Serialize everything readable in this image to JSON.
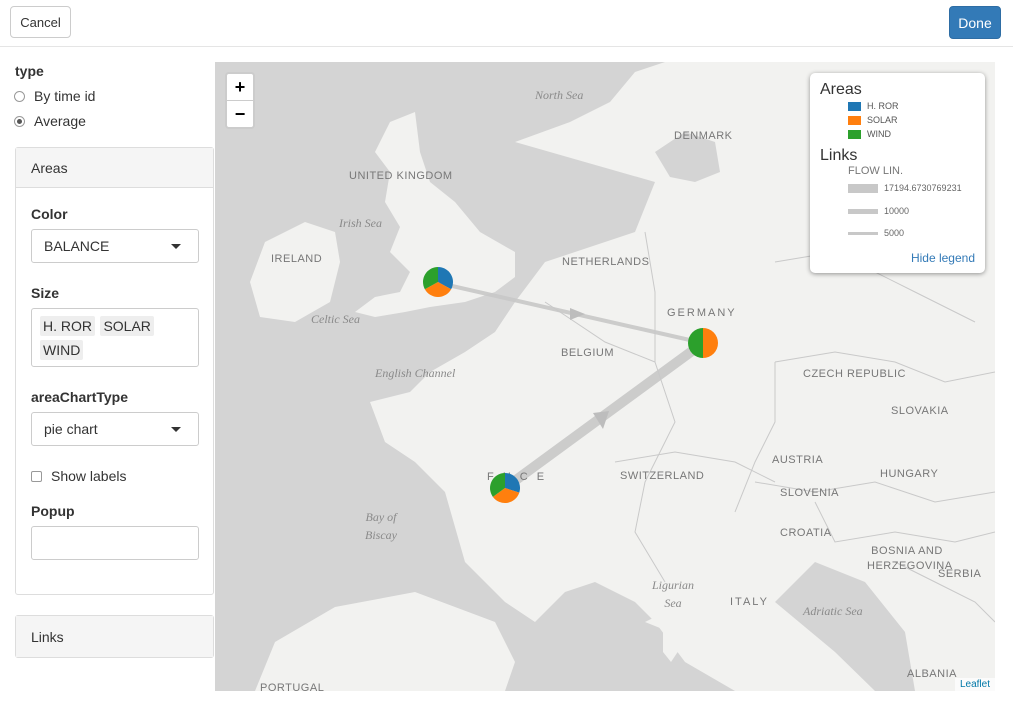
{
  "header": {
    "cancel_label": "Cancel",
    "done_label": "Done"
  },
  "sidebar": {
    "type_label": "type",
    "type_options": [
      "By time id",
      "Average"
    ],
    "type_selected": "Average",
    "areas_panel": {
      "title": "Areas",
      "color_label": "Color",
      "color_value": "BALANCE",
      "size_label": "Size",
      "size_tags": [
        "H. ROR",
        "SOLAR",
        "WIND"
      ],
      "chart_type_label": "areaChartType",
      "chart_type_value": "pie chart",
      "show_labels": "Show labels",
      "popup_label": "Popup",
      "popup_value": ""
    },
    "links_panel": {
      "title": "Links"
    }
  },
  "map": {
    "zoom_in": "+",
    "zoom_out": "−",
    "attribution": "Leaflet",
    "labels": {
      "north_sea": "North Sea",
      "denmark": "DENMARK",
      "uk": "UNITED KINGDOM",
      "irish_sea": "Irish Sea",
      "ireland": "IRELAND",
      "netherlands": "NETHERLANDS",
      "germany": "GERMANY",
      "celtic_sea": "Celtic Sea",
      "belgium": "BELGIUM",
      "english_channel": "English Channel",
      "czech": "CZECH REPUBLIC",
      "slovakia": "SLOVAKIA",
      "austria": "AUSTRIA",
      "hungary": "HUNGARY",
      "switzerland": "SWITZERLAND",
      "france": "F   N C E",
      "slovenia": "SLOVENIA",
      "croatia": "CROATIA",
      "bay_biscay": "Bay of Biscay",
      "bosnia": "BOSNIA AND HERZEGOVINA",
      "serbia": "SERBIA",
      "ligurian": "Ligurian Sea",
      "italy": "ITALY",
      "adriatic": "Adriatic Sea",
      "albania": "ALBANIA",
      "portugal": "PORTUGAL"
    },
    "legend": {
      "areas_title": "Areas",
      "areas": [
        {
          "name": "H. ROR",
          "color": "#1f77b4"
        },
        {
          "name": "SOLAR",
          "color": "#ff7f0e"
        },
        {
          "name": "WIND",
          "color": "#2ca02c"
        }
      ],
      "links_title": "Links",
      "links_subtitle": "FLOW LIN.",
      "link_values": [
        "17194.6730769231",
        "10000",
        "5000"
      ],
      "hide_label": "Hide legend"
    },
    "node_pies": [
      {
        "area": "uk",
        "fractions": [
          0.33,
          0.34,
          0.33
        ]
      },
      {
        "area": "de",
        "fractions": [
          0.0,
          0.5,
          0.5
        ]
      },
      {
        "area": "fr",
        "fractions": [
          0.3,
          0.35,
          0.35
        ]
      }
    ]
  }
}
